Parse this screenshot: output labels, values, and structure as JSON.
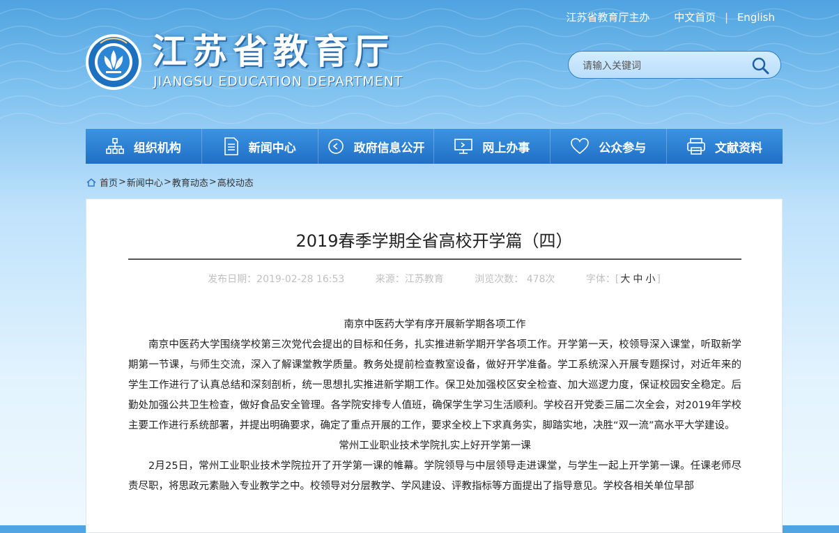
{
  "header": {
    "host_text": "江苏省教育厅主办",
    "home_link": "中文首页",
    "separator": "|",
    "english_link": "English",
    "logo_title": "江苏省教育厅",
    "logo_subtitle": "JIANGSU EDUCATION DEPARTMENT",
    "emblem_text": "江苏省教育厅"
  },
  "search": {
    "placeholder": "请输入关键词",
    "icon": "search-icon"
  },
  "nav": {
    "items": [
      {
        "label": "组织机构",
        "icon": "org-chart-icon"
      },
      {
        "label": "新闻中心",
        "icon": "document-icon"
      },
      {
        "label": "政府信息公开",
        "icon": "play-circle-icon"
      },
      {
        "label": "网上办事",
        "icon": "monitor-icon"
      },
      {
        "label": "公众参与",
        "icon": "heart-icon"
      },
      {
        "label": "文献资料",
        "icon": "printer-icon"
      }
    ]
  },
  "breadcrumb": {
    "icon": "home-icon",
    "items": [
      "首页",
      "新闻中心",
      "教育动态",
      "高校动态"
    ],
    "sep": ">"
  },
  "article": {
    "title": "2019春季学期全省高校开学篇（四）",
    "date_label": "发布日期：2019-02-28 16:53",
    "source_label": "来源：江苏教育",
    "views_label": "浏览次数： 478次",
    "font_label": "字体：",
    "font_open": "[",
    "font_large": "大",
    "font_medium": "中",
    "font_small": "小",
    "font_close": "]",
    "sections": [
      {
        "heading": "南京中医药大学有序开展新学期各项工作",
        "text": "南京中医药大学围绕学校第三次党代会提出的目标和任务，扎实推进新学期开学各项工作。开学第一天，校领导深入课堂，听取新学期第一节课，与师生交流，深入了解课堂教学质量。教务处提前检查教室设备，做好开学准备。学工系统深入开展专题探讨，对近年来的学生工作进行了认真总结和深刻剖析，统一思想扎实推进新学期工作。保卫处加强校区安全检查、加大巡逻力度，保证校园安全稳定。后勤处加强公共卫生检查，做好食品安全管理。各学院安排专人值班，确保学生学习生活顺利。学校召开党委三届二次全会，对2019年学校主要工作进行系统部署，并提出明确要求，确定了重点开展的工作，要求全校上下求真务实，脚踏实地，决胜“双一流”高水平大学建设。"
      },
      {
        "heading": "常州工业职业技术学院扎实上好开学第一课",
        "text": "2月25日，常州工业职业技术学院拉开了开学第一课的帷幕。学院领导与中层领导走进课堂，与学生一起上开学第一课。任课老师尽责尽职，将思政元素融入专业教学之中。校领导对分层教学、学风建设、评教指标等方面提出了指导意见。学校各相关单位早部"
      }
    ]
  }
}
